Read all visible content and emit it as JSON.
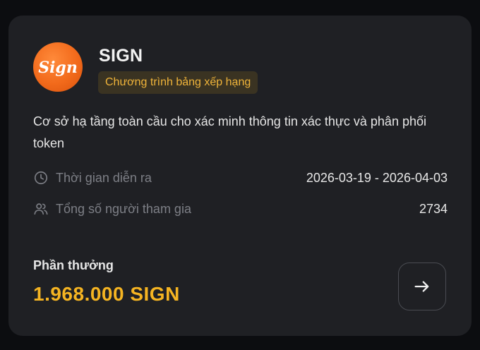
{
  "project": {
    "logo_text": "Sign",
    "name": "SIGN",
    "badge": "Chương trình bảng xếp hạng",
    "description": "Cơ sở hạ tầng toàn cầu cho xác minh thông tin xác thực và phân phối token"
  },
  "details": {
    "time": {
      "icon": "clock-icon",
      "label": "Thời gian diễn ra",
      "value": "2026-03-19 - 2026-04-03"
    },
    "participants": {
      "icon": "users-icon",
      "label": "Tổng số người tham gia",
      "value": "2734"
    }
  },
  "reward": {
    "label": "Phần thưởng",
    "value": "1.968.000 SIGN"
  },
  "actions": {
    "open_icon": "arrow-right-icon"
  },
  "colors": {
    "accent": "#f5b422",
    "badge_bg": "#3a3322",
    "logo": "#f26a1b",
    "card_bg": "#1f2024"
  }
}
